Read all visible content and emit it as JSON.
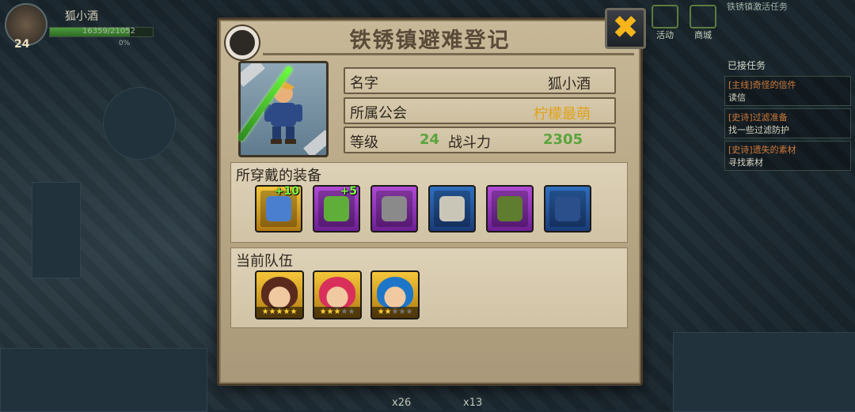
{
  "hud": {
    "player_name": "狐小酒",
    "hp_text": "16359/21052",
    "hp_fraction": 0.78,
    "level": "24",
    "exp_pct": "0%",
    "top_buttons": [
      "活动",
      "商城"
    ],
    "quest_header_top": "铁锈镇激活任务",
    "quest_header": "已接任务",
    "quests": [
      {
        "type": "[主线]奇怪的信件",
        "desc": "读信"
      },
      {
        "type": "[史诗]过滤准备",
        "desc": "找一些过滤防护"
      },
      {
        "type": "[史诗]遗失的素材",
        "desc": "寻找素材"
      }
    ],
    "counters": [
      "x26",
      "x13"
    ]
  },
  "dialog": {
    "title": "铁锈镇避难登记",
    "close_label": "✖",
    "name_label": "名字",
    "name_value": "狐小酒",
    "guild_label": "所属公会",
    "guild_value": "柠檬最萌",
    "level_label": "等级",
    "level_value": "24",
    "power_label": "战斗力",
    "power_value": "2305",
    "equipment_title": "所穿戴的装备",
    "equipment": [
      {
        "name": "weapon-shotgun",
        "rarity": "gold",
        "enhance": "+10",
        "color": "#4a7fd0"
      },
      {
        "name": "gas-mask",
        "rarity": "purple",
        "enhance": "+5",
        "color": "#5fae3a"
      },
      {
        "name": "gauntlet",
        "rarity": "purple",
        "enhance": "",
        "color": "#8a8a8a"
      },
      {
        "name": "necklace",
        "rarity": "blue",
        "enhance": "",
        "color": "#c9c6b8"
      },
      {
        "name": "boots",
        "rarity": "purple",
        "enhance": "",
        "color": "#5e7d2e"
      },
      {
        "name": "armor-case",
        "rarity": "blue",
        "enhance": "",
        "color": "#2a4f8a"
      }
    ],
    "team_title": "当前队伍",
    "team": [
      {
        "name": "member-1",
        "stars": 5,
        "lit": 5,
        "hair": "#5a2b1d"
      },
      {
        "name": "member-2",
        "stars": 5,
        "lit": 3,
        "hair": "#d8305a"
      },
      {
        "name": "member-3",
        "stars": 5,
        "lit": 2,
        "hair": "#1e76c8"
      }
    ]
  },
  "colors": {
    "title": "#5a4b39",
    "guild": "#e1a21c",
    "stat_green": "#5aa43c",
    "close_icon": "#f6b51a"
  }
}
